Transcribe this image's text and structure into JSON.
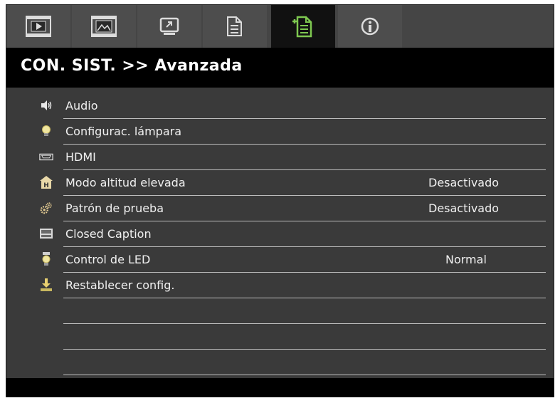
{
  "tabs": [
    {
      "name": "play-image-icon",
      "active": false
    },
    {
      "name": "film-display-icon",
      "active": false
    },
    {
      "name": "screen-setup-icon",
      "active": false
    },
    {
      "name": "document-settings-icon",
      "active": false
    },
    {
      "name": "system-options-icon",
      "active": true
    },
    {
      "name": "info-icon",
      "active": false
    }
  ],
  "header": {
    "title": "CON. SIST. >> Avanzada"
  },
  "menu": {
    "items": [
      {
        "label": "Audio",
        "value": "",
        "icon": "speaker-icon"
      },
      {
        "label": "Configurac. lámpara",
        "value": "",
        "icon": "lamp-icon"
      },
      {
        "label": "HDMI",
        "value": "",
        "icon": "hdmi-icon"
      },
      {
        "label": "Modo altitud elevada",
        "value": "Desactivado",
        "icon": "high-altitude-icon"
      },
      {
        "label": "Patrón de prueba",
        "value": "Desactivado",
        "icon": "gears-icon"
      },
      {
        "label": "Closed Caption",
        "value": "",
        "icon": "closed-caption-icon"
      },
      {
        "label": "Control de LED",
        "value": "Normal",
        "icon": "led-icon"
      },
      {
        "label": "Restablecer config.",
        "value": "",
        "icon": "reset-download-icon"
      },
      {
        "label": "",
        "value": "",
        "icon": ""
      },
      {
        "label": "",
        "value": "",
        "icon": ""
      },
      {
        "label": "",
        "value": "",
        "icon": ""
      }
    ]
  },
  "colors": {
    "background": "#3a3a3a",
    "active_tab": "#111111",
    "active_icon": "#7ec850",
    "inactive_icon": "#dcdcdc",
    "text": "#f0f0f0"
  }
}
